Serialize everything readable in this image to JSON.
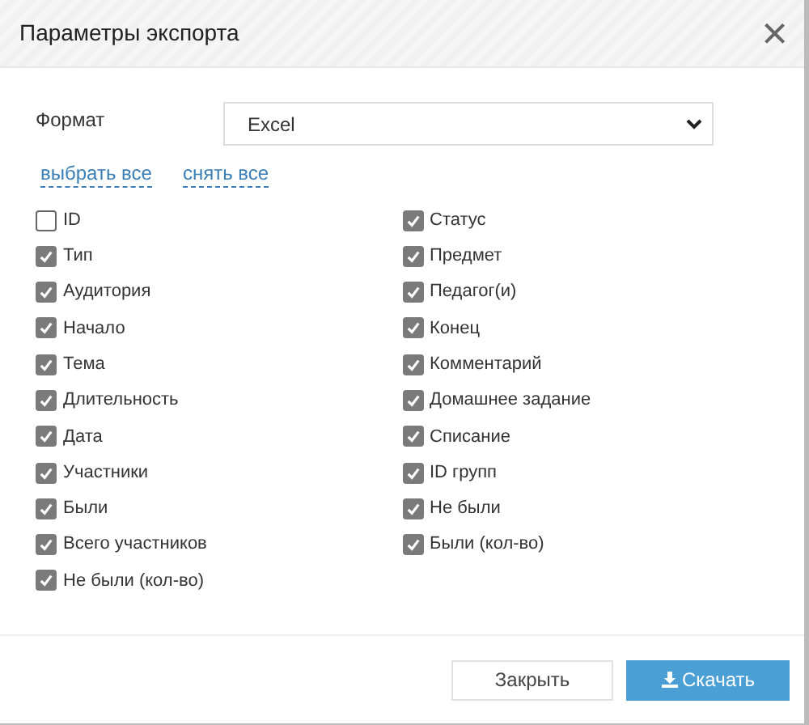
{
  "dialog": {
    "title": "Параметры экспорта",
    "close": "×"
  },
  "format": {
    "label": "Формат",
    "value": "Excel"
  },
  "links": [
    "выбрать все",
    "снять все"
  ],
  "columns": [
    [
      {
        "label": "ID",
        "checked": false
      },
      {
        "label": "Тип",
        "checked": true
      },
      {
        "label": "Аудитория",
        "checked": true
      },
      {
        "label": "Начало",
        "checked": true
      },
      {
        "label": "Тема",
        "checked": true
      },
      {
        "label": "Длительность",
        "checked": true
      },
      {
        "label": "Дата",
        "checked": true
      },
      {
        "label": "Участники",
        "checked": true
      },
      {
        "label": "Были",
        "checked": true
      },
      {
        "label": "Всего участников",
        "checked": true
      },
      {
        "label": "Не были (кол-во)",
        "checked": true
      }
    ],
    [
      {
        "label": "Статус",
        "checked": true
      },
      {
        "label": "Предмет",
        "checked": true
      },
      {
        "label": "Педагог(и)",
        "checked": true
      },
      {
        "label": "Конец",
        "checked": true
      },
      {
        "label": "Комментарий",
        "checked": true
      },
      {
        "label": "Домашнее задание",
        "checked": true
      },
      {
        "label": "Списание",
        "checked": true
      },
      {
        "label": "ID групп",
        "checked": true
      },
      {
        "label": "Не были",
        "checked": true
      },
      {
        "label": "Были (кол-во)",
        "checked": true
      }
    ]
  ],
  "buttons": [
    {
      "label": "Закрыть",
      "kind": "secondary"
    },
    {
      "label": "Скачать",
      "kind": "primary"
    }
  ]
}
